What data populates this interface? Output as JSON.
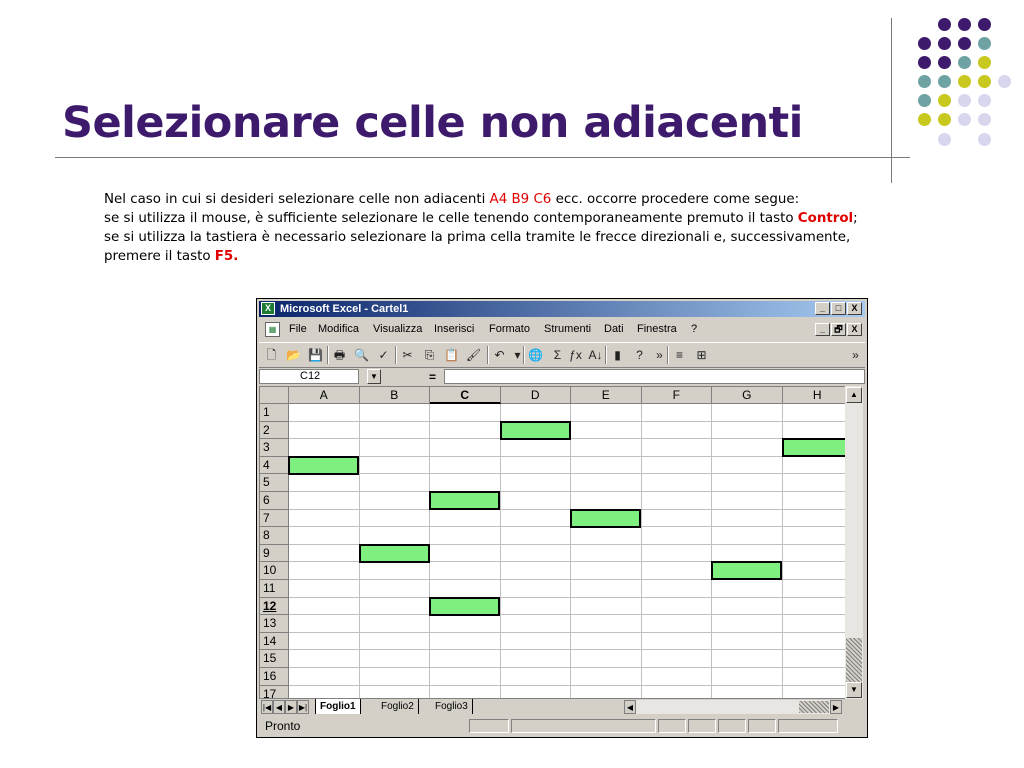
{
  "colors": {
    "dot_purple": "#3d1a6b",
    "dot_teal": "#6fa3a3",
    "dot_lime": "#c8c81e",
    "dot_lavender": "#d8d6ec",
    "title": "#3d1a6b",
    "highlight_red": "#e00000",
    "selected_cell_fill": "#7ff07f"
  },
  "slide": {
    "title": "Selezionare celle non adiacenti",
    "para1_before": "Nel caso in cui si desideri selezionare  celle non adiacenti ",
    "para1_cells": "A4 B9 C6",
    "para1_after": " ecc. occorre procedere come segue:",
    "para2_before": "se si utilizza il mouse, è sufficiente selezionare le celle tenendo contemporaneamente premuto il tasto ",
    "para2_key": "Control",
    "para2_after": ";",
    "para3": "se si utilizza la tastiera è necessario selezionare la prima cella tramite le frecce direzionali e, successivamente,",
    "para4_before": "premere il tasto ",
    "para4_key": "F5."
  },
  "excel": {
    "window_title": "Microsoft Excel - Cartel1",
    "window_buttons": [
      "_",
      "□",
      "X"
    ],
    "menu": [
      "File",
      "Modifica",
      "Visualizza",
      "Inserisci",
      "Formato",
      "Strumenti",
      "Dati",
      "Finestra",
      "?"
    ],
    "doc_buttons": [
      "_",
      "🗗",
      "X"
    ],
    "toolbar_icons": [
      "new-icon",
      "open-icon",
      "save-icon",
      "print-icon",
      "print-preview-icon",
      "spelling-icon",
      "cut-icon",
      "copy-icon",
      "paste-icon",
      "format-painter-icon",
      "undo-icon",
      "undo-dropdown-icon",
      "hyperlink-icon",
      "autosum-icon",
      "function-icon",
      "sort-ascending-icon",
      "chart-wizard-icon",
      "help-icon",
      "more-icon",
      "align-icon",
      "merge-center-icon",
      "toolbar-options-icon"
    ],
    "toolbar_glyphs": [
      "🗋",
      "📂",
      "💾",
      "🖶",
      "🔍",
      "✓",
      "✂",
      "⎘",
      "📋",
      "🖌",
      "↶",
      "▾",
      "🌐",
      "Σ",
      "ƒx",
      "A↓",
      "▮",
      "?",
      "»",
      "≡",
      "⊞",
      "»"
    ],
    "name_box": "C12",
    "name_box_arrow": "▼",
    "formula_equals": "=",
    "columns": [
      "A",
      "B",
      "C",
      "D",
      "E",
      "F",
      "G",
      "H"
    ],
    "active_column": "C",
    "rows": [
      "1",
      "2",
      "3",
      "4",
      "5",
      "6",
      "7",
      "8",
      "9",
      "10",
      "11",
      "12",
      "13",
      "14",
      "15",
      "16",
      "17"
    ],
    "active_row": "12",
    "selected_cells": [
      "D2",
      "H3",
      "A4",
      "C6",
      "E7",
      "B9",
      "G10",
      "C12"
    ],
    "scroll_up": "▲",
    "scroll_down": "▼",
    "sheet_nav": [
      "|◀",
      "◀",
      "▶",
      "▶|"
    ],
    "sheet_tabs": [
      "Foglio1",
      "Foglio2",
      "Foglio3"
    ],
    "active_sheet": "Foglio1",
    "hscroll_left": "◀",
    "hscroll_right": "▶",
    "status_text": "Pronto"
  }
}
